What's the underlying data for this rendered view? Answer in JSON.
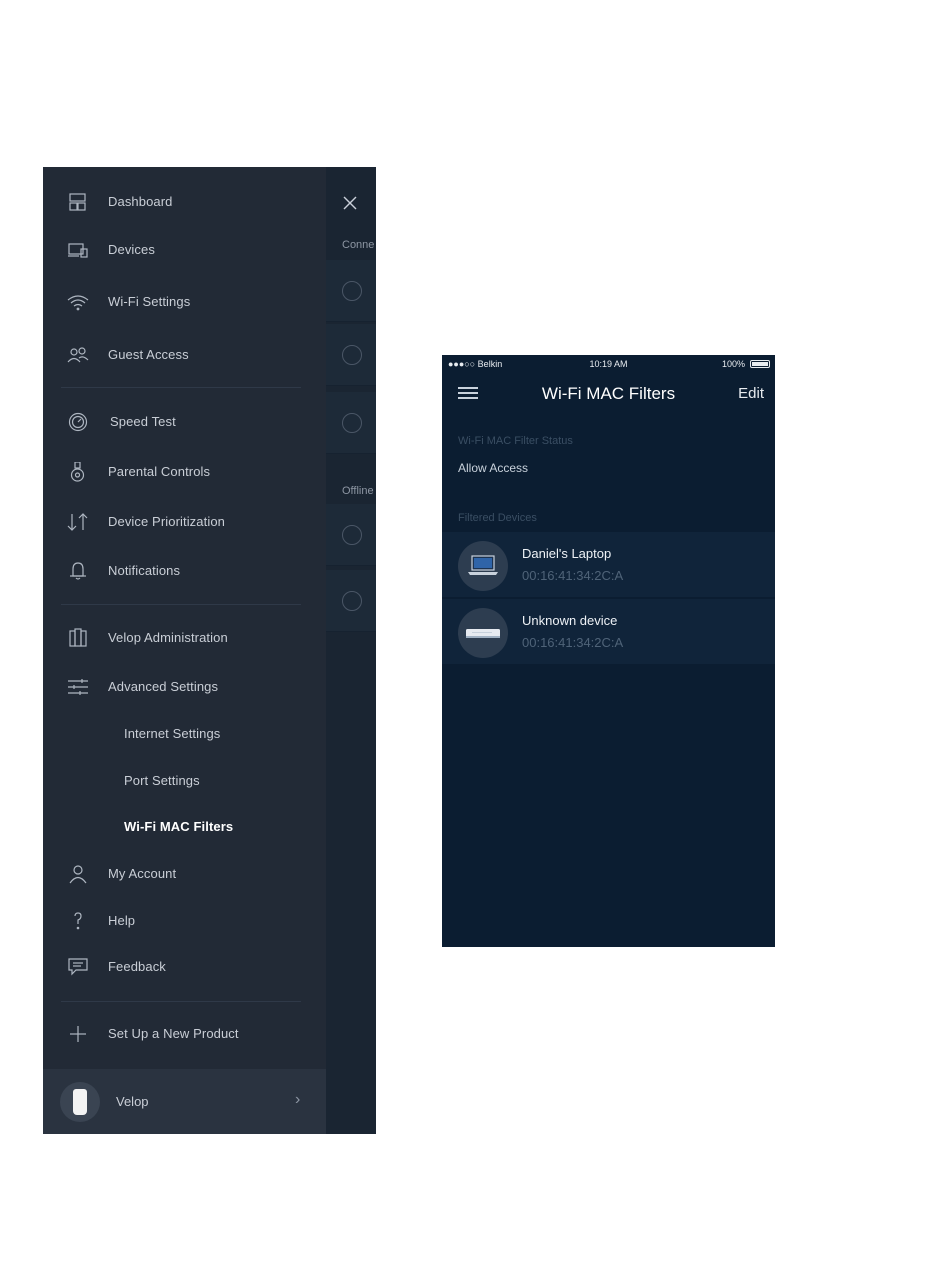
{
  "drawer": {
    "items": [
      {
        "label": "Dashboard",
        "icon": "dashboard-icon"
      },
      {
        "label": "Devices",
        "icon": "devices-icon"
      },
      {
        "label": "Wi-Fi Settings",
        "icon": "wifi-icon"
      },
      {
        "label": "Guest Access",
        "icon": "guest-icon"
      },
      {
        "label": "Speed Test",
        "icon": "speedometer-icon"
      },
      {
        "label": "Parental Controls",
        "icon": "parental-controls-icon"
      },
      {
        "label": "Device Prioritization",
        "icon": "prioritization-arrows-icon"
      },
      {
        "label": "Notifications",
        "icon": "bell-icon"
      },
      {
        "label": "Velop Administration",
        "icon": "velop-admin-icon"
      },
      {
        "label": "Advanced Settings",
        "icon": "sliders-icon"
      },
      {
        "label": "Internet Settings"
      },
      {
        "label": "Port Settings"
      },
      {
        "label": "Wi-Fi MAC Filters"
      },
      {
        "label": "My Account",
        "icon": "person-icon"
      },
      {
        "label": "Help",
        "icon": "question-icon"
      },
      {
        "label": "Feedback",
        "icon": "chat-bubble-icon"
      },
      {
        "label": "Set Up a New Product",
        "icon": "plus-icon"
      }
    ],
    "footer": {
      "label": "Velop",
      "chevron": "›"
    }
  },
  "behind": {
    "connected_header": "Conne",
    "offline_header": "Offline"
  },
  "mac_screen": {
    "status_bar": {
      "carrier": "●●●○○ Belkin",
      "time": "10:19 AM",
      "battery": "100%"
    },
    "title": "Wi-Fi MAC Filters",
    "edit": "Edit",
    "status_label": "Wi-Fi MAC Filter Status",
    "status_value": "Allow Access",
    "filtered_label": "Filtered Devices",
    "devices": [
      {
        "name": "Daniel's Laptop",
        "mac": "00:16:41:34:2C:A",
        "icon": "laptop-icon"
      },
      {
        "name": "Unknown device",
        "mac": "00:16:41:34:2C:A",
        "icon": "generic-device-icon"
      }
    ]
  }
}
